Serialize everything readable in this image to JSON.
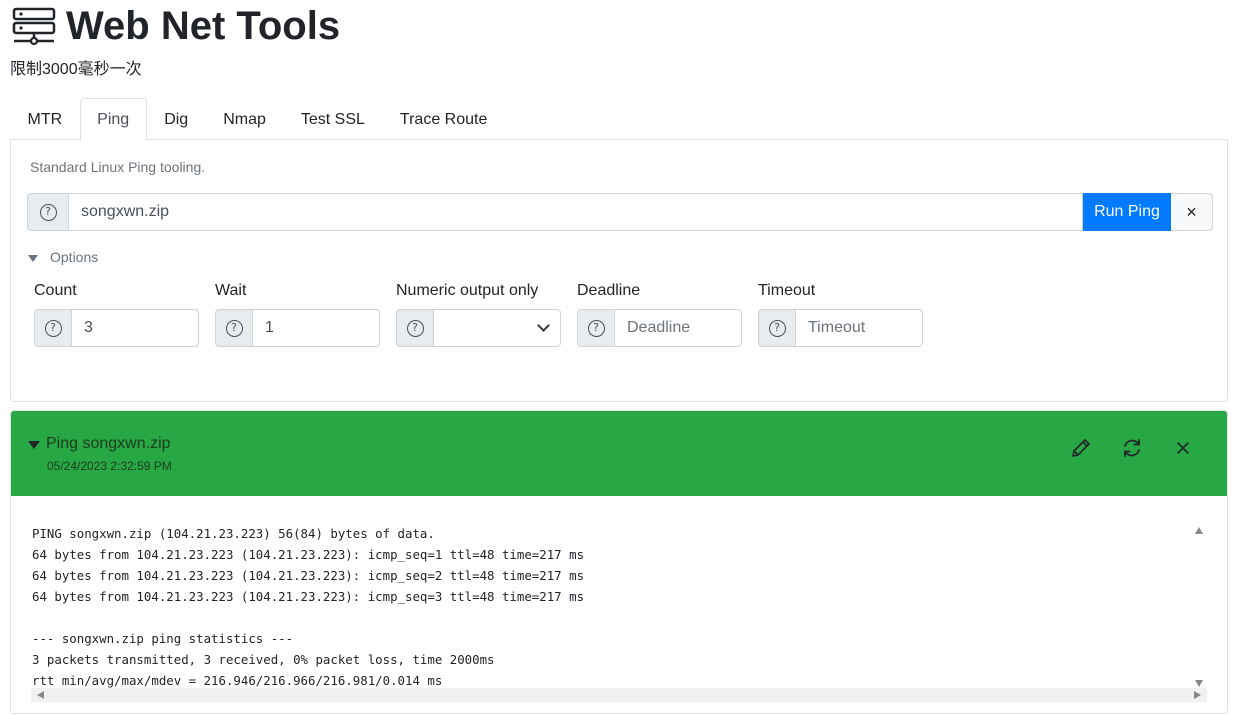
{
  "app": {
    "title": "Web Net Tools",
    "subtitle": "限制3000毫秒一次",
    "logo_icon": "network-server-icon"
  },
  "tabs": [
    {
      "label": "MTR",
      "active": false
    },
    {
      "label": "Ping",
      "active": true
    },
    {
      "label": "Dig",
      "active": false
    },
    {
      "label": "Nmap",
      "active": false
    },
    {
      "label": "Test SSL",
      "active": false
    },
    {
      "label": "Trace Route",
      "active": false
    }
  ],
  "ping_panel": {
    "description": "Standard Linux Ping tooling.",
    "help_icon": "question-circle-icon",
    "host_value": "songxwn.zip",
    "run_label": "Run Ping",
    "clear_label": "×",
    "options_label": "Options",
    "options_expanded": true,
    "fields": {
      "count": {
        "label": "Count",
        "value": "3"
      },
      "wait": {
        "label": "Wait",
        "value": "1"
      },
      "numeric": {
        "label": "Numeric output only",
        "value": ""
      },
      "deadline": {
        "label": "Deadline",
        "placeholder": "Deadline"
      },
      "timeout": {
        "label": "Timeout",
        "placeholder": "Timeout"
      }
    }
  },
  "result": {
    "title": "Ping songxwn.zip",
    "timestamp": "05/24/2023 2:32:59 PM",
    "status_color": "#28a745",
    "actions": [
      "edit-icon",
      "refresh-icon",
      "close-icon"
    ],
    "output": "PING songxwn.zip (104.21.23.223) 56(84) bytes of data.\n64 bytes from 104.21.23.223 (104.21.23.223): icmp_seq=1 ttl=48 time=217 ms\n64 bytes from 104.21.23.223 (104.21.23.223): icmp_seq=2 ttl=48 time=217 ms\n64 bytes from 104.21.23.223 (104.21.23.223): icmp_seq=3 ttl=48 time=217 ms\n\n--- songxwn.zip ping statistics ---\n3 packets transmitted, 3 received, 0% packet loss, time 2000ms\nrtt min/avg/max/mdev = 216.946/216.966/216.981/0.014 ms"
  },
  "colors": {
    "primary": "#007bff",
    "success": "#28a745",
    "border": "#ced4da"
  }
}
